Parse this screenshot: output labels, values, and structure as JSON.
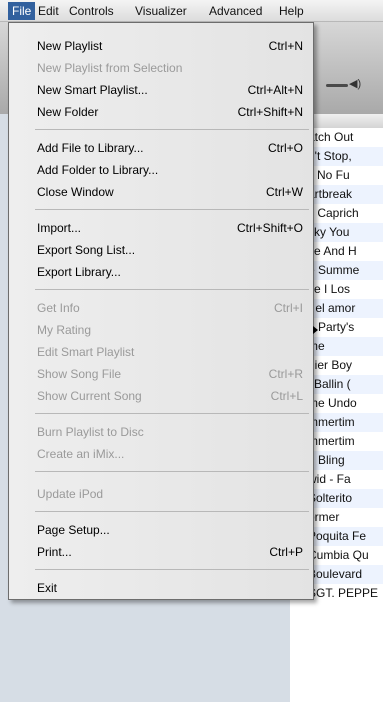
{
  "menubar": {
    "items": [
      {
        "label": "File"
      },
      {
        "label": "Edit"
      },
      {
        "label": "Controls"
      },
      {
        "label": "Visualizer"
      },
      {
        "label": "Advanced"
      },
      {
        "label": "Help"
      }
    ]
  },
  "file_menu": {
    "items": [
      {
        "label": "New Playlist",
        "shortcut": "Ctrl+N",
        "enabled": true
      },
      {
        "label": "New Playlist from Selection",
        "shortcut": "",
        "enabled": false
      },
      {
        "label": "New Smart Playlist...",
        "shortcut": "Ctrl+Alt+N",
        "enabled": true
      },
      {
        "label": "New Folder",
        "shortcut": "Ctrl+Shift+N",
        "enabled": true
      },
      {
        "label": "Add File to Library...",
        "shortcut": "Ctrl+O",
        "enabled": true
      },
      {
        "label": "Add Folder to Library...",
        "shortcut": "",
        "enabled": true
      },
      {
        "label": "Close Window",
        "shortcut": "Ctrl+W",
        "enabled": true
      },
      {
        "label": "Import...",
        "shortcut": "Ctrl+Shift+O",
        "enabled": true
      },
      {
        "label": "Export Song List...",
        "shortcut": "",
        "enabled": true
      },
      {
        "label": "Export Library...",
        "shortcut": "",
        "enabled": true
      },
      {
        "label": "Get Info",
        "shortcut": "Ctrl+I",
        "enabled": false
      },
      {
        "label": "My Rating",
        "shortcut": "",
        "enabled": false
      },
      {
        "label": "Edit Smart Playlist",
        "shortcut": "",
        "enabled": false
      },
      {
        "label": "Show Song File",
        "shortcut": "Ctrl+R",
        "enabled": false
      },
      {
        "label": "Show Current Song",
        "shortcut": "Ctrl+L",
        "enabled": false
      },
      {
        "label": "Burn Playlist to Disc",
        "shortcut": "",
        "enabled": false
      },
      {
        "label": "Create an iMix...",
        "shortcut": "",
        "enabled": false
      },
      {
        "label": "Update iPod",
        "shortcut": "",
        "enabled": false
      },
      {
        "label": "Page Setup...",
        "shortcut": "",
        "enabled": true
      },
      {
        "label": "Print...",
        "shortcut": "Ctrl+P",
        "enabled": true
      },
      {
        "label": "Exit",
        "shortcut": "",
        "enabled": true
      }
    ]
  },
  "songs": [
    {
      "name": "atch Out",
      "checked": false
    },
    {
      "name": "n't Stop,",
      "checked": false
    },
    {
      "name": "'t No Fu",
      "checked": false
    },
    {
      "name": "artbreak",
      "checked": false
    },
    {
      "name": "s Caprich",
      "checked": false
    },
    {
      "name": "cky You",
      "checked": false
    },
    {
      "name": "ve And H",
      "checked": false
    },
    {
      "name": "e Summe",
      "checked": false
    },
    {
      "name": "ce I Los",
      "checked": false
    },
    {
      "name": "r el amor",
      "checked": false
    },
    {
      "name": "e Party's",
      "checked": false
    },
    {
      "name": "me",
      "checked": false
    },
    {
      "name": "dier Boy",
      "checked": false
    },
    {
      "name": "l Ballin (",
      "checked": false
    },
    {
      "name": "me Undo",
      "checked": false
    },
    {
      "name": "mmertim",
      "checked": false
    },
    {
      "name": "mmertim",
      "checked": false
    },
    {
      "name": "g Bling",
      "checked": false
    },
    {
      "name": "wid - Fa",
      "checked": false
    },
    {
      "name": "Solterito",
      "checked": false
    },
    {
      "name": "ormer",
      "checked": false
    },
    {
      "name": "Poquita Fe",
      "checked": true
    },
    {
      "name": "Cumbia Qu",
      "checked": true
    },
    {
      "name": "Boulevard",
      "checked": true
    },
    {
      "name": "SGT. PEPPE",
      "checked": true
    }
  ],
  "volume_icon": "speaker-icon",
  "checkmark": "✔"
}
